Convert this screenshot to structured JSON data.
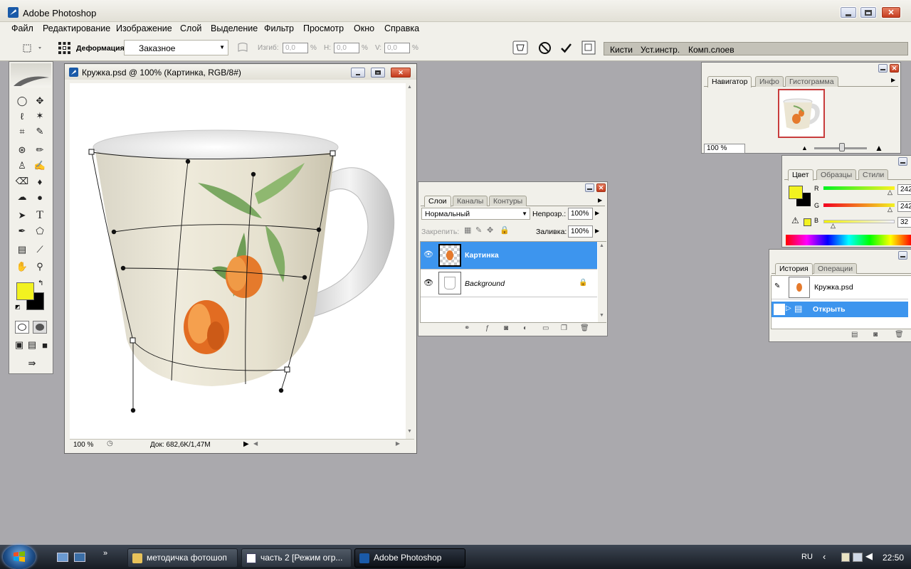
{
  "app": {
    "title": "Adobe Photoshop",
    "menu": [
      "Файл",
      "Редактирование",
      "Изображение",
      "Слой",
      "Выделение",
      "Фильтр",
      "Просмотр",
      "Окно",
      "Справка"
    ]
  },
  "options": {
    "deform_label": "Деформация:",
    "deform_value": "Заказное",
    "bend_label": "Изгиб:",
    "bend_value": "0,0",
    "h_label": "H:",
    "h_value": "0,0",
    "v_label": "V:",
    "v_value": "0,0",
    "percent": "%",
    "well_tabs": [
      "Кисти",
      "Уст.инстр.",
      "Комп.слоев"
    ]
  },
  "document": {
    "title": "Кружка.psd @ 100% (Картинка, RGB/8#)",
    "zoom": "100 %",
    "doc_info": "Док: 682,6K/1,47M"
  },
  "navigator": {
    "tabs": [
      "Навигатор",
      "Инфо",
      "Гистограмма"
    ],
    "zoom": "100 %"
  },
  "color_panel": {
    "tabs": [
      "Цвет",
      "Образцы",
      "Стили"
    ],
    "channels": [
      {
        "label": "R",
        "value": "242"
      },
      {
        "label": "G",
        "value": "242"
      },
      {
        "label": "B",
        "value": "32"
      }
    ],
    "foreground": "#f2f220",
    "background": "#000000"
  },
  "layers": {
    "tabs": [
      "Слои",
      "Каналы",
      "Контуры"
    ],
    "blend_mode": "Нормальный",
    "opacity_label": "Непрозр.:",
    "opacity_value": "100%",
    "lock_label": "Закрепить:",
    "fill_label": "Заливка:",
    "fill_value": "100%",
    "items": [
      {
        "name": "Картинка",
        "selected": true
      },
      {
        "name": "Background",
        "selected": false
      }
    ]
  },
  "history": {
    "tabs": [
      "История",
      "Операции"
    ],
    "snapshot": "Кружка.psd",
    "items": [
      {
        "label": "Открыть"
      }
    ]
  },
  "taskbar": {
    "items": [
      "методичка фотошоп",
      "часть 2 [Режим огр...",
      "Adobe Photoshop"
    ],
    "lang": "RU",
    "time": "22:50"
  }
}
